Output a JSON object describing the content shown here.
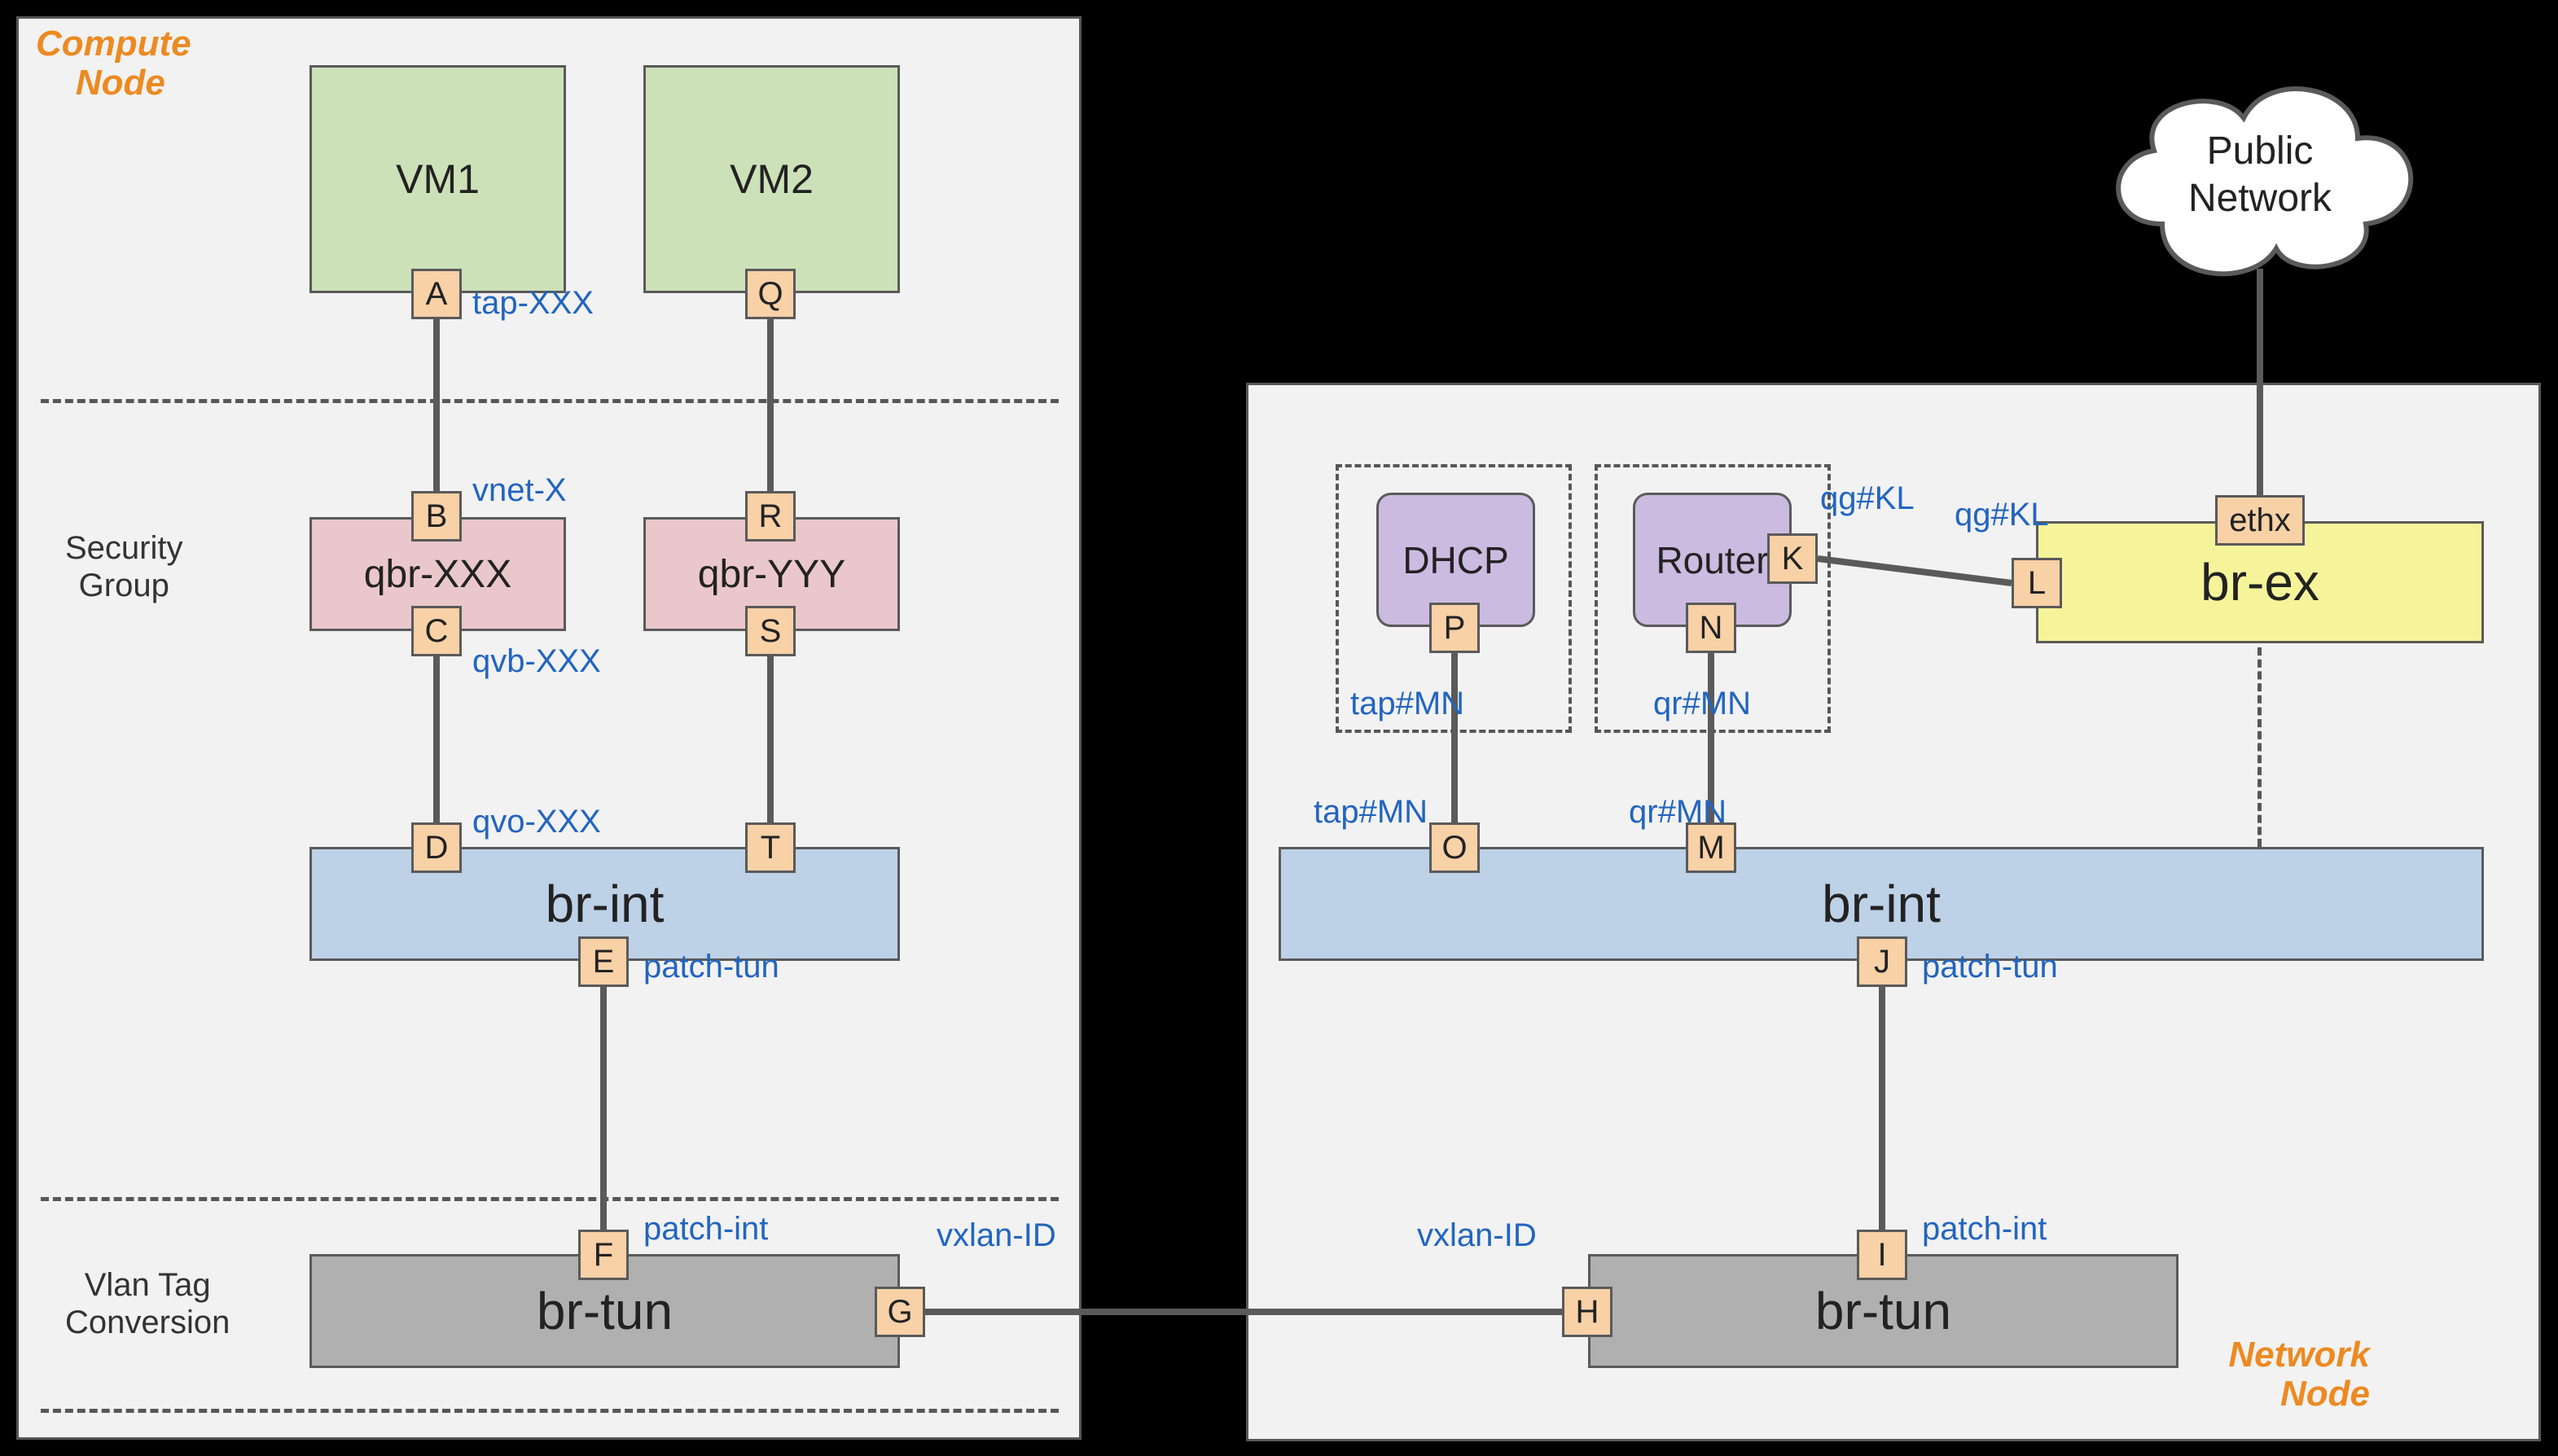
{
  "compute": {
    "title": "Compute\n    Node",
    "vm1": "VM1",
    "vm2": "VM2",
    "secgroup": "Security\nGroup",
    "qbr1": "qbr-XXX",
    "qbr2": "qbr-YYY",
    "brint": "br-int",
    "brtun": "br-tun",
    "vlantag": "Vlan Tag\nConversion",
    "ports": {
      "A": "A",
      "B": "B",
      "C": "C",
      "D": "D",
      "E": "E",
      "F": "F",
      "G": "G",
      "Q": "Q",
      "R": "R",
      "S": "S",
      "T": "T"
    },
    "lbl": {
      "tapxxx": "tap-XXX",
      "vnetx": "vnet-X",
      "qvbxxx": "qvb-XXX",
      "qvoxxx": "qvo-XXX",
      "patchtun": "patch-tun",
      "patchint": "patch-int",
      "vxlanid": "vxlan-ID"
    }
  },
  "network": {
    "title": "Network\n       Node",
    "dhcp": "DHCP",
    "router": "Router",
    "brint": "br-int",
    "brtun": "br-tun",
    "brex": "br-ex",
    "ports": {
      "H": "H",
      "I": "I",
      "J": "J",
      "K": "K",
      "L": "L",
      "M": "M",
      "N": "N",
      "O": "O",
      "P": "P",
      "ethx": "ethx"
    },
    "lbl": {
      "vxlanid": "vxlan-ID",
      "patchint": "patch-int",
      "patchtun": "patch-tun",
      "qrMN_low": "qr#MN",
      "qrMN_up": "qr#MN",
      "tapMN_low": "tap#MN",
      "tapMN_up": "tap#MN",
      "qgKL1": "qg#KL",
      "qgKL2": "qg#KL"
    }
  },
  "cloud": {
    "line1": "Public",
    "line2": "Network"
  }
}
